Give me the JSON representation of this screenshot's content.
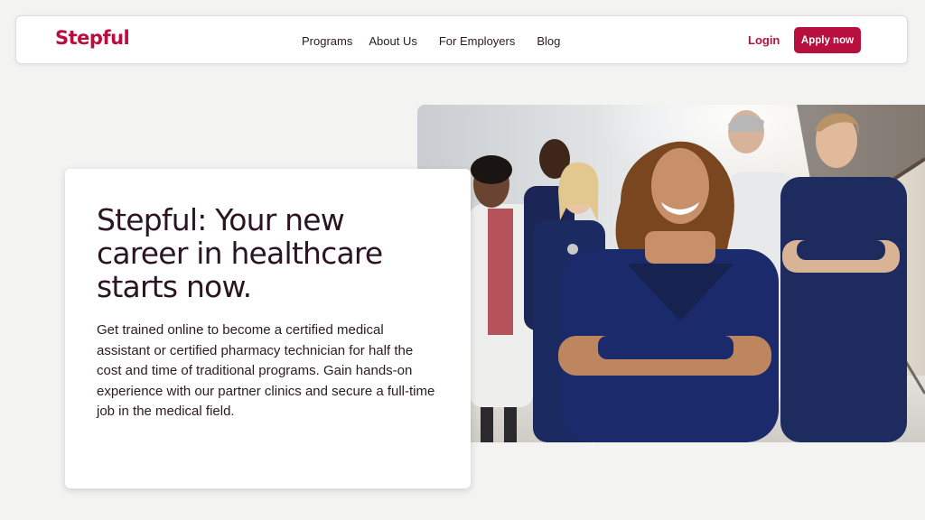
{
  "brand": {
    "name": "Stepful",
    "color": "#b8103e"
  },
  "nav": {
    "links": [
      "Programs",
      "About Us",
      "For Employers",
      "Blog"
    ],
    "login_label": "Login",
    "apply_label": "Apply now"
  },
  "hero": {
    "title": "Stepful: Your new career in healthcare starts now.",
    "description": "Get trained online to become a certified medical assistant or certified pharmacy technician for half the cost and time of traditional programs. Gain hands-on experience with our partner clinics and secure a full-time job in the medical field."
  },
  "colors": {
    "page_background": "#f3f3f2",
    "text_dark": "#2b1520",
    "scrubs_navy": "#1d2b5e"
  }
}
